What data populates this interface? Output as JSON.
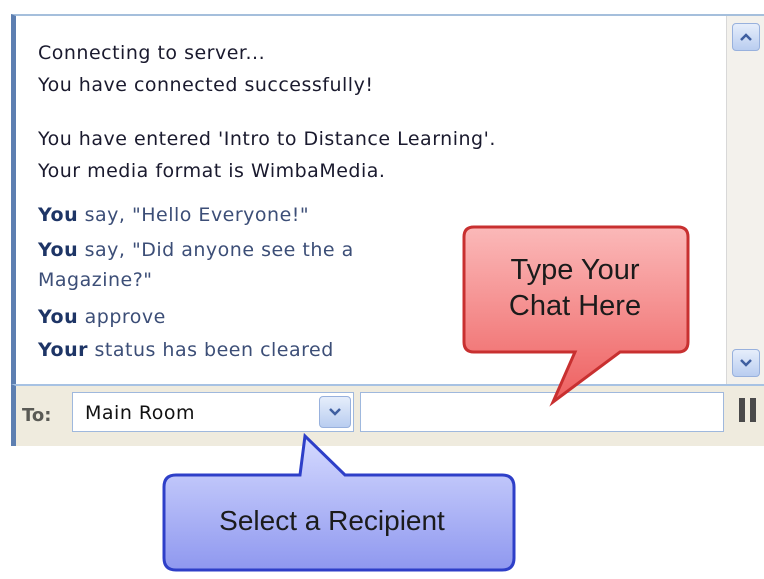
{
  "chat_log": {
    "lines": [
      "Connecting to server...",
      "You have connected successfully!",
      "You have entered 'Intro to Distance Learning'.",
      "Your media format is WimbaMedia."
    ],
    "messages": [
      {
        "who": "You",
        "text": " say, \"Hello Everyone!\""
      },
      {
        "who": "You",
        "text": " say, \"Did anyone see the a"
      },
      {
        "who": "",
        "text": "Magazine?\""
      },
      {
        "who": "You",
        "text": " approve"
      },
      {
        "who": "Your",
        "text": " status has been cleared"
      }
    ]
  },
  "scrollbar": {
    "up_icon": "chevron-up-icon",
    "down_icon": "chevron-down-icon"
  },
  "toolbar": {
    "to_label": "To:",
    "recipient_value": "Main Room",
    "dropdown_icon": "chevron-down-icon",
    "chat_input_value": "",
    "pause_icon": "pause-icon"
  },
  "callouts": {
    "chat_here_line1": "Type Your",
    "chat_here_line2": "Chat Here",
    "select_recipient": "Select a Recipient"
  },
  "colors": {
    "red_callout": "#f47b7b",
    "blue_callout": "#a9b2f3",
    "toolbar_bg": "#efebde"
  }
}
